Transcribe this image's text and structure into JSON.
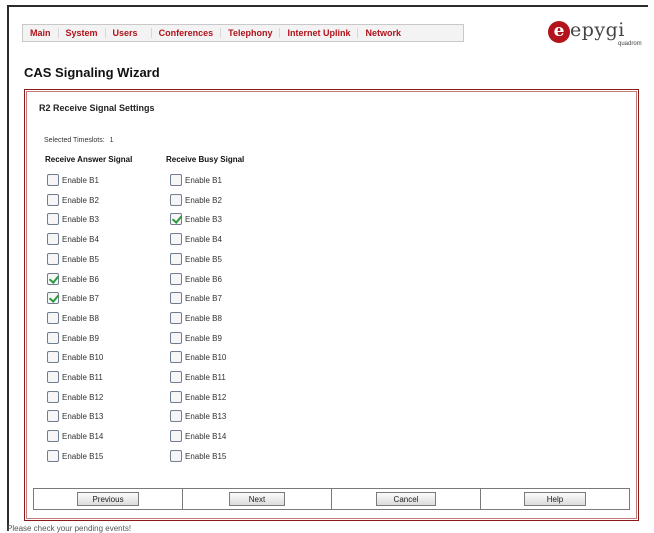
{
  "nav": {
    "items": [
      "Main",
      "System",
      "Users",
      "Conferences",
      "Telephony",
      "Internet Uplink",
      "Network"
    ]
  },
  "logo": {
    "brand_initial": "e",
    "brand_word": "epygi",
    "brand_sub": "quadrom"
  },
  "page": {
    "title": "CAS Signaling Wizard"
  },
  "panel": {
    "section_title": "R2 Receive Signal Settings",
    "timeslots_label": "Selected Timeslots:",
    "timeslots_value": "1",
    "columns": {
      "answer_header": "Receive Answer Signal",
      "busy_header": "Receive Busy Signal"
    },
    "answer_signals": [
      {
        "label": "Enable B1",
        "checked": false
      },
      {
        "label": "Enable B2",
        "checked": false
      },
      {
        "label": "Enable B3",
        "checked": false
      },
      {
        "label": "Enable B4",
        "checked": false
      },
      {
        "label": "Enable B5",
        "checked": false
      },
      {
        "label": "Enable B6",
        "checked": true
      },
      {
        "label": "Enable B7",
        "checked": true
      },
      {
        "label": "Enable B8",
        "checked": false
      },
      {
        "label": "Enable B9",
        "checked": false
      },
      {
        "label": "Enable B10",
        "checked": false
      },
      {
        "label": "Enable B11",
        "checked": false
      },
      {
        "label": "Enable B12",
        "checked": false
      },
      {
        "label": "Enable B13",
        "checked": false
      },
      {
        "label": "Enable B14",
        "checked": false
      },
      {
        "label": "Enable B15",
        "checked": false
      }
    ],
    "busy_signals": [
      {
        "label": "Enable B1",
        "checked": false
      },
      {
        "label": "Enable B2",
        "checked": false
      },
      {
        "label": "Enable B3",
        "checked": true
      },
      {
        "label": "Enable B4",
        "checked": false
      },
      {
        "label": "Enable B5",
        "checked": false
      },
      {
        "label": "Enable B6",
        "checked": false
      },
      {
        "label": "Enable B7",
        "checked": false
      },
      {
        "label": "Enable B8",
        "checked": false
      },
      {
        "label": "Enable B9",
        "checked": false
      },
      {
        "label": "Enable B10",
        "checked": false
      },
      {
        "label": "Enable B11",
        "checked": false
      },
      {
        "label": "Enable B12",
        "checked": false
      },
      {
        "label": "Enable B13",
        "checked": false
      },
      {
        "label": "Enable B14",
        "checked": false
      },
      {
        "label": "Enable B15",
        "checked": false
      }
    ]
  },
  "buttons": {
    "previous": "Previous",
    "next": "Next",
    "cancel": "Cancel",
    "help": "Help"
  },
  "footer": {
    "note": "Please check your pending events!"
  },
  "colors": {
    "accent_red": "#b0121a",
    "panel_border": "#8a1a1a",
    "check_green": "#2a9a3a"
  }
}
